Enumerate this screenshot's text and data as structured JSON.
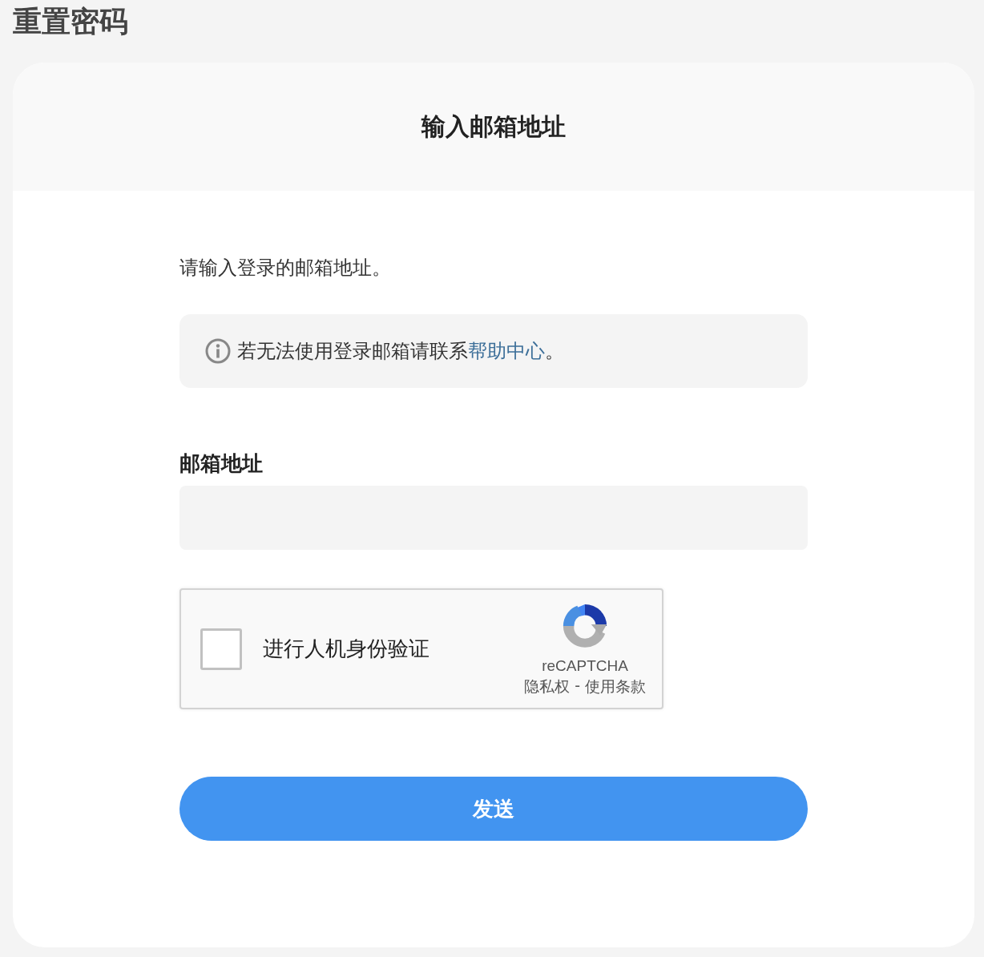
{
  "page_title": "重置密码",
  "card": {
    "heading": "输入邮箱地址"
  },
  "instruction": "请输入登录的邮箱地址。",
  "notice": {
    "text": "若无法使用登录邮箱请联系",
    "link": "帮助中心",
    "suffix": "。"
  },
  "email_field": {
    "label": "邮箱地址"
  },
  "captcha": {
    "checked": false,
    "label": "进行人机身份验证",
    "brand": "reCAPTCHA",
    "privacy_link": "隐私权",
    "separator": "-",
    "terms_link": "使用条款"
  },
  "send_button": "发送"
}
